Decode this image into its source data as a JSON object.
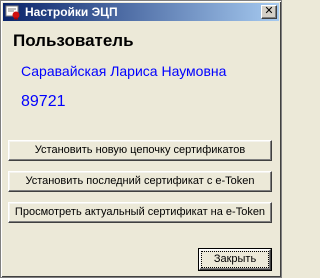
{
  "window": {
    "title": "Настройки ЭЦП",
    "close_glyph": "✕"
  },
  "section": {
    "title": "Пользователь"
  },
  "user": {
    "name": "Саравайская Лариса Наумовна",
    "id": "89721"
  },
  "buttons": {
    "install_chain": "Установить новую цепочку сертификатов",
    "install_last": "Установить последний сертификат с e-Token",
    "view_current": "Просмотреть актуальный сертификат на e-Token",
    "close": "Закрыть"
  },
  "colors": {
    "titlebar_start": "#0a246a",
    "titlebar_end": "#a6caf0",
    "user_text": "#0000ff",
    "window_bg": "#ece9d8"
  },
  "icons": {
    "app": "certificate-seal-icon"
  }
}
